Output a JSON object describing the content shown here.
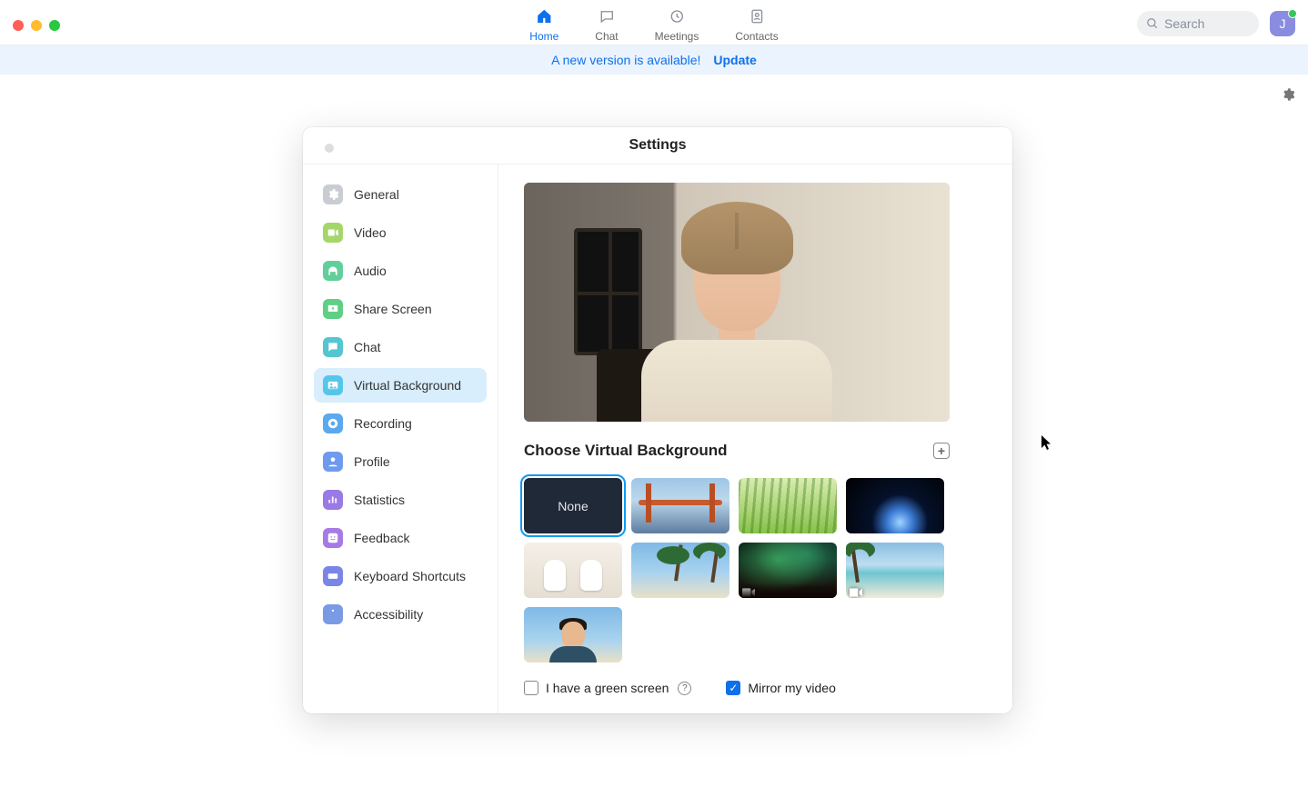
{
  "nav": {
    "tabs": [
      {
        "label": "Home",
        "active": true
      },
      {
        "label": "Chat",
        "active": false
      },
      {
        "label": "Meetings",
        "active": false
      },
      {
        "label": "Contacts",
        "active": false
      }
    ],
    "search_placeholder": "Search",
    "avatar_initial": "J"
  },
  "banner": {
    "text": "A new version is available!",
    "link": "Update"
  },
  "settings": {
    "title": "Settings",
    "sidebar": [
      {
        "label": "General",
        "color": "#c9cdd3",
        "icon": "gear"
      },
      {
        "label": "Video",
        "color": "#a5d66a",
        "icon": "video"
      },
      {
        "label": "Audio",
        "color": "#62cf9a",
        "icon": "headphones"
      },
      {
        "label": "Share Screen",
        "color": "#5fcf84",
        "icon": "share"
      },
      {
        "label": "Chat",
        "color": "#55c6cf",
        "icon": "chat"
      },
      {
        "label": "Virtual Background",
        "color": "#55c6ea",
        "icon": "image",
        "active": true
      },
      {
        "label": "Recording",
        "color": "#5aa9ef",
        "icon": "record"
      },
      {
        "label": "Profile",
        "color": "#6f9bef",
        "icon": "person"
      },
      {
        "label": "Statistics",
        "color": "#9a7ae6",
        "icon": "stats"
      },
      {
        "label": "Feedback",
        "color": "#a77ae6",
        "icon": "smile"
      },
      {
        "label": "Keyboard Shortcuts",
        "color": "#7a86e6",
        "icon": "keyboard"
      },
      {
        "label": "Accessibility",
        "color": "#7a9ae6",
        "icon": "accessibility"
      }
    ],
    "section_label": "Choose Virtual Background",
    "thumbnails": [
      {
        "kind": "none",
        "label": "None",
        "selected": true
      },
      {
        "kind": "bridge"
      },
      {
        "kind": "grass"
      },
      {
        "kind": "earth"
      },
      {
        "kind": "astro"
      },
      {
        "kind": "palm1"
      },
      {
        "kind": "aurora",
        "video": true
      },
      {
        "kind": "beach",
        "video": true
      },
      {
        "kind": "person"
      }
    ],
    "checkboxes": {
      "green_screen": {
        "label": "I have a green screen",
        "checked": false
      },
      "mirror": {
        "label": "Mirror my video",
        "checked": true
      }
    }
  }
}
